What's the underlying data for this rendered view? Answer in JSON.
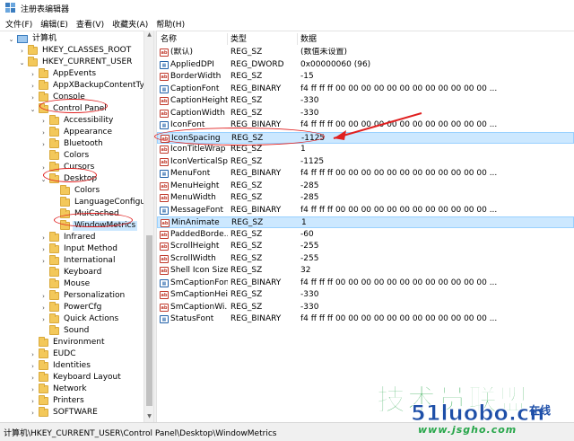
{
  "window": {
    "title": "注册表编辑器"
  },
  "menu": [
    "文件(F)",
    "编辑(E)",
    "查看(V)",
    "收藏夹(A)",
    "帮助(H)"
  ],
  "tree": {
    "nodes": [
      {
        "label": "计算机",
        "expander": "v",
        "kind": "computer"
      },
      {
        "label": "HKEY_CLASSES_ROOT",
        "expander": ">",
        "kind": "folder"
      },
      {
        "label": "HKEY_CURRENT_USER",
        "expander": "v",
        "kind": "folder"
      },
      {
        "label": "AppEvents",
        "expander": ">",
        "kind": "folder"
      },
      {
        "label": "AppXBackupContentType",
        "expander": ">",
        "kind": "folder"
      },
      {
        "label": "Console",
        "expander": ">",
        "kind": "folder"
      },
      {
        "label": "Control Panel",
        "expander": "v",
        "kind": "folder"
      },
      {
        "label": "Accessibility",
        "expander": ">",
        "kind": "folder"
      },
      {
        "label": "Appearance",
        "expander": ">",
        "kind": "folder"
      },
      {
        "label": "Bluetooth",
        "expander": ">",
        "kind": "folder"
      },
      {
        "label": "Colors",
        "expander": "",
        "kind": "folder"
      },
      {
        "label": "Cursors",
        "expander": ">",
        "kind": "folder"
      },
      {
        "label": "Desktop",
        "expander": "v",
        "kind": "folder"
      },
      {
        "label": "Colors",
        "expander": "",
        "kind": "folder"
      },
      {
        "label": "LanguageConfigurat",
        "expander": "",
        "kind": "folder"
      },
      {
        "label": "MuiCached",
        "expander": "",
        "kind": "folder"
      },
      {
        "label": "WindowMetrics",
        "expander": "",
        "kind": "folder",
        "selected": true
      },
      {
        "label": "Infrared",
        "expander": ">",
        "kind": "folder"
      },
      {
        "label": "Input Method",
        "expander": ">",
        "kind": "folder"
      },
      {
        "label": "International",
        "expander": ">",
        "kind": "folder"
      },
      {
        "label": "Keyboard",
        "expander": "",
        "kind": "folder"
      },
      {
        "label": "Mouse",
        "expander": "",
        "kind": "folder"
      },
      {
        "label": "Personalization",
        "expander": ">",
        "kind": "folder"
      },
      {
        "label": "PowerCfg",
        "expander": ">",
        "kind": "folder"
      },
      {
        "label": "Quick Actions",
        "expander": ">",
        "kind": "folder"
      },
      {
        "label": "Sound",
        "expander": "",
        "kind": "folder"
      },
      {
        "label": "Environment",
        "expander": "",
        "kind": "folder"
      },
      {
        "label": "EUDC",
        "expander": ">",
        "kind": "folder"
      },
      {
        "label": "Identities",
        "expander": ">",
        "kind": "folder"
      },
      {
        "label": "Keyboard Layout",
        "expander": ">",
        "kind": "folder"
      },
      {
        "label": "Network",
        "expander": ">",
        "kind": "folder"
      },
      {
        "label": "Printers",
        "expander": ">",
        "kind": "folder"
      },
      {
        "label": "SOFTWARE",
        "expander": ">",
        "kind": "folder"
      }
    ]
  },
  "values": {
    "headers": {
      "name": "名称",
      "type": "类型",
      "data": "数据"
    },
    "rows": [
      {
        "icon": "ab",
        "name": "(默认)",
        "type": "REG_SZ",
        "data": "(数值未设置)"
      },
      {
        "icon": "bin",
        "name": "AppliedDPI",
        "type": "REG_DWORD",
        "data": "0x00000060 (96)"
      },
      {
        "icon": "ab",
        "name": "BorderWidth",
        "type": "REG_SZ",
        "data": "-15"
      },
      {
        "icon": "bin",
        "name": "CaptionFont",
        "type": "REG_BINARY",
        "data": "f4 ff ff ff 00 00 00 00 00 00 00 00 00 00 00 00 ..."
      },
      {
        "icon": "ab",
        "name": "CaptionHeight",
        "type": "REG_SZ",
        "data": "-330"
      },
      {
        "icon": "ab",
        "name": "CaptionWidth",
        "type": "REG_SZ",
        "data": "-330"
      },
      {
        "icon": "bin",
        "name": "IconFont",
        "type": "REG_BINARY",
        "data": "f4 ff ff ff 00 00 00 00 00 00 00 00 00 00 00 00 ..."
      },
      {
        "icon": "ab",
        "name": "IconSpacing",
        "type": "REG_SZ",
        "data": "-1125",
        "highlight": true
      },
      {
        "icon": "ab",
        "name": "IconTitleWrap",
        "type": "REG_SZ",
        "data": "1"
      },
      {
        "icon": "ab",
        "name": "IconVerticalSp...",
        "type": "REG_SZ",
        "data": "-1125"
      },
      {
        "icon": "bin",
        "name": "MenuFont",
        "type": "REG_BINARY",
        "data": "f4 ff ff ff 00 00 00 00 00 00 00 00 00 00 00 00 ..."
      },
      {
        "icon": "ab",
        "name": "MenuHeight",
        "type": "REG_SZ",
        "data": "-285"
      },
      {
        "icon": "ab",
        "name": "MenuWidth",
        "type": "REG_SZ",
        "data": "-285"
      },
      {
        "icon": "bin",
        "name": "MessageFont",
        "type": "REG_BINARY",
        "data": "f4 ff ff ff 00 00 00 00 00 00 00 00 00 00 00 00 ..."
      },
      {
        "icon": "ab",
        "name": "MinAnimate",
        "type": "REG_SZ",
        "data": "1",
        "highlight": true
      },
      {
        "icon": "ab",
        "name": "PaddedBorde...",
        "type": "REG_SZ",
        "data": "-60"
      },
      {
        "icon": "ab",
        "name": "ScrollHeight",
        "type": "REG_SZ",
        "data": "-255"
      },
      {
        "icon": "ab",
        "name": "ScrollWidth",
        "type": "REG_SZ",
        "data": "-255"
      },
      {
        "icon": "ab",
        "name": "Shell Icon Size",
        "type": "REG_SZ",
        "data": "32"
      },
      {
        "icon": "bin",
        "name": "SmCaptionFont",
        "type": "REG_BINARY",
        "data": "f4 ff ff ff 00 00 00 00 00 00 00 00 00 00 00 00 ..."
      },
      {
        "icon": "ab",
        "name": "SmCaptionHei...",
        "type": "REG_SZ",
        "data": "-330"
      },
      {
        "icon": "ab",
        "name": "SmCaptionWi...",
        "type": "REG_SZ",
        "data": "-330"
      },
      {
        "icon": "bin",
        "name": "StatusFont",
        "type": "REG_BINARY",
        "data": "f4 ff ff ff 00 00 00 00 00 00 00 00 00 00 00 00 ..."
      }
    ]
  },
  "status": {
    "path": "计算机\\HKEY_CURRENT_USER\\Control Panel\\Desktop\\WindowMetrics"
  },
  "watermark": {
    "main": "技术员联盟",
    "site": "51luobo.cn",
    "side": "在线",
    "sub": "www.jsgho.com"
  },
  "colors": {
    "annotation": "#e02020",
    "selection": "#cce8ff",
    "watermark_green": "#27a64a",
    "watermark_blue": "#1e4fa8"
  }
}
